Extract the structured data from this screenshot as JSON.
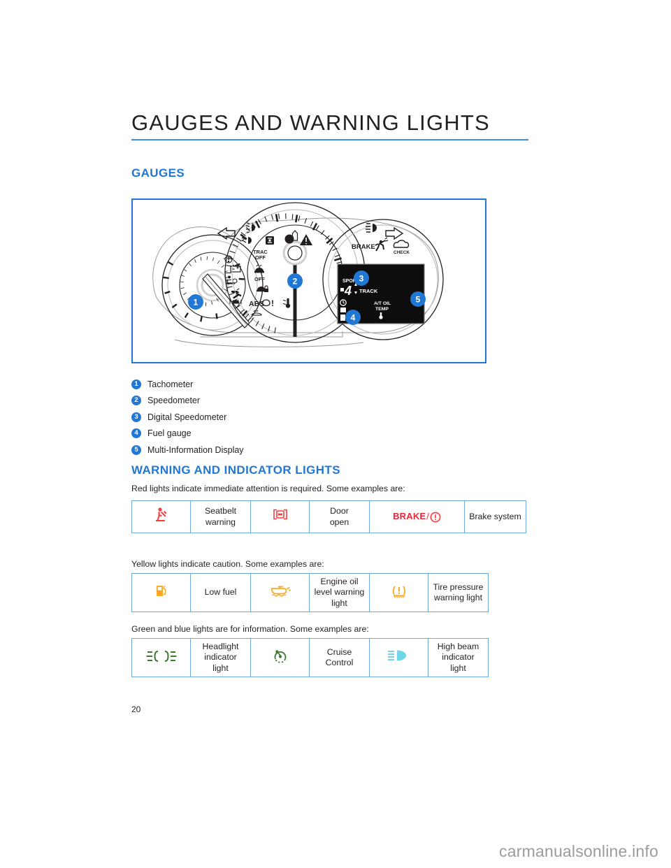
{
  "chapter": {
    "title": "GAUGES AND WARNING LIGHTS",
    "rule_color": "#3f8fdc"
  },
  "sections": {
    "gauges_heading": "GAUGES",
    "warning_heading": "WARNING AND INDICATOR LIGHTS"
  },
  "cluster_figure": {
    "callouts": [
      {
        "number": "1",
        "target": "tachometer"
      },
      {
        "number": "2",
        "target": "speedometer"
      },
      {
        "number": "3",
        "target": "digital-speedometer"
      },
      {
        "number": "4",
        "target": "fuel-gauge"
      },
      {
        "number": "5",
        "target": "multi-information-display"
      }
    ],
    "labels": {
      "abs": "ABS",
      "trac_off": "TRAC\nOFF",
      "vdc_off": "OFF",
      "brake": "BRAKE",
      "check": "CHECK",
      "sport": "SPORT",
      "track": "TRACK",
      "gear": "4",
      "at_oil_temp": "A/T OIL\nTEMP"
    },
    "border_color": "#2178d4"
  },
  "legend": {
    "items": [
      {
        "number": "1",
        "label": "Tachometer"
      },
      {
        "number": "2",
        "label": "Speedometer"
      },
      {
        "number": "3",
        "label": "Digital Speedometer"
      },
      {
        "number": "4",
        "label": "Fuel gauge"
      },
      {
        "number": "5",
        "label": "Multi-Information Display"
      }
    ],
    "badge_color": "#2178d4"
  },
  "red_lights": {
    "intro": "Red lights indicate immediate attention is required. Some examples are:",
    "color": "#ff3b3b",
    "rows": [
      {
        "icon": "seatbelt-warning-icon",
        "label": "Seatbelt\nwarning"
      },
      {
        "icon": "door-open-icon",
        "label": "Door\nopen"
      },
      {
        "icon": "brake-system-icon",
        "brake_word": "BRAKE",
        "separator": "/",
        "label": "Brake system"
      }
    ]
  },
  "yellow_lights": {
    "intro": "Yellow lights indicate caution. Some examples are:",
    "color": "#f9a825",
    "rows": [
      {
        "icon": "low-fuel-icon",
        "label": "Low fuel"
      },
      {
        "icon": "engine-oil-level-icon",
        "label": "Engine oil\nlevel warning\nlight"
      },
      {
        "icon": "tire-pressure-icon",
        "label": "Tire pressure\nwarning light"
      }
    ]
  },
  "green_blue_lights": {
    "intro": "Green and blue lights are for information. Some examples are:",
    "green_color": "#3c7a30",
    "blue_color": "#6fd8e8",
    "rows": [
      {
        "icon": "headlight-indicator-icon",
        "label": "Headlight\nindicator\nlight"
      },
      {
        "icon": "cruise-control-icon",
        "label": "Cruise\nControl"
      },
      {
        "icon": "high-beam-indicator-icon",
        "label": "High beam\nindicator\nlight"
      }
    ]
  },
  "footer": {
    "page_number": "20",
    "watermark": "carmanualsonline.info"
  }
}
